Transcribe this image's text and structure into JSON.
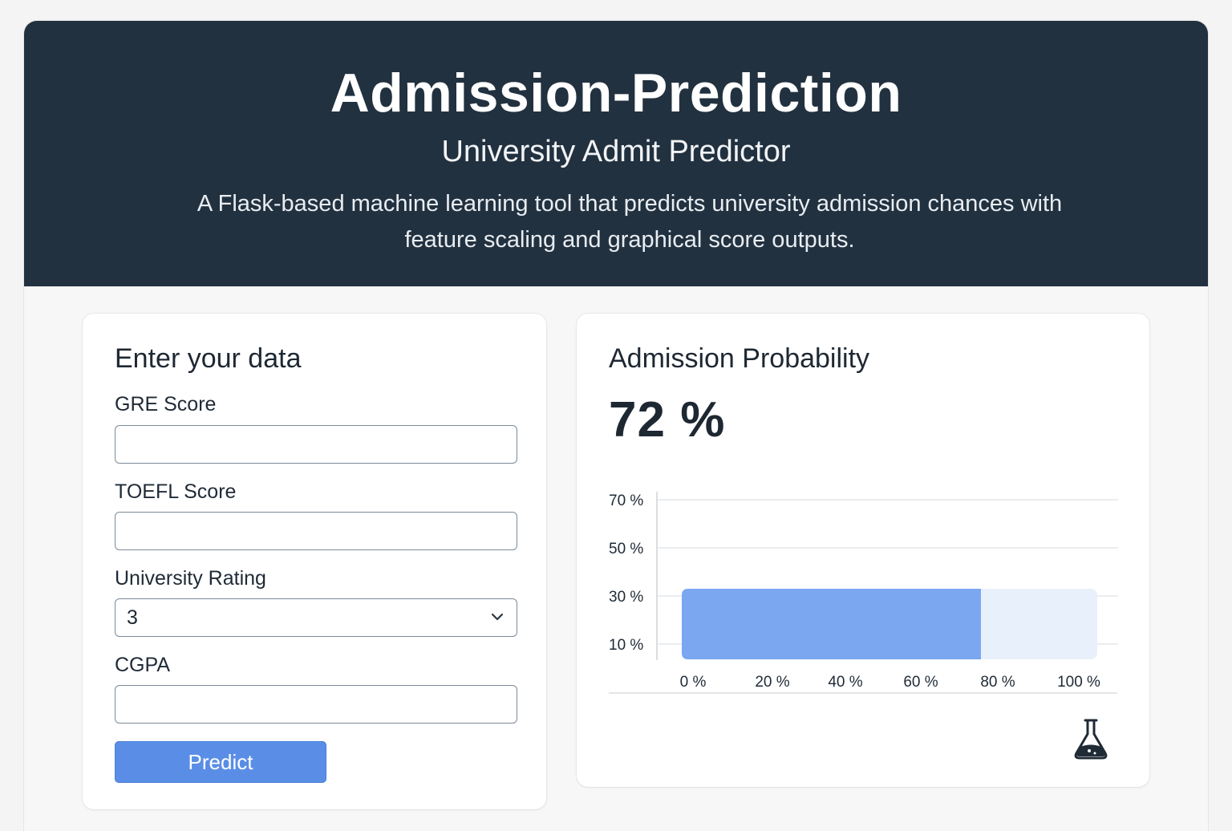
{
  "header": {
    "title": "Admission-Prediction",
    "subtitle": "University Admit Predictor",
    "description": "A Flask-based machine learning tool that predicts university admission chances with feature scaling and graphical score outputs."
  },
  "form": {
    "title": "Enter your data",
    "fields": [
      {
        "label": "GRE Score",
        "value": "",
        "placeholder": ""
      },
      {
        "label": "TOEFL Score",
        "value": "",
        "placeholder": ""
      },
      {
        "label": "University Rating",
        "value": "3"
      },
      {
        "label": "CGPA",
        "value": "",
        "placeholder": ""
      }
    ],
    "submit_label": "Predict"
  },
  "result": {
    "title": "Admission Probability",
    "value_text": "72 %",
    "icon": "flask-icon"
  },
  "chart_data": {
    "type": "bar",
    "orientation": "horizontal",
    "value": 72,
    "max": 100,
    "x_ticks": [
      "0 %",
      "20 %",
      "40 %",
      "60 %",
      "80 %",
      "100 %"
    ],
    "y_ticks": [
      "70 %",
      "50 %",
      "30 %",
      "10 %"
    ],
    "grid": true,
    "bar_color": "#7aa7f0",
    "track_color": "#e8f0fb"
  },
  "colors": {
    "header_bg": "#22313f",
    "accent": "#5a8ee6"
  }
}
